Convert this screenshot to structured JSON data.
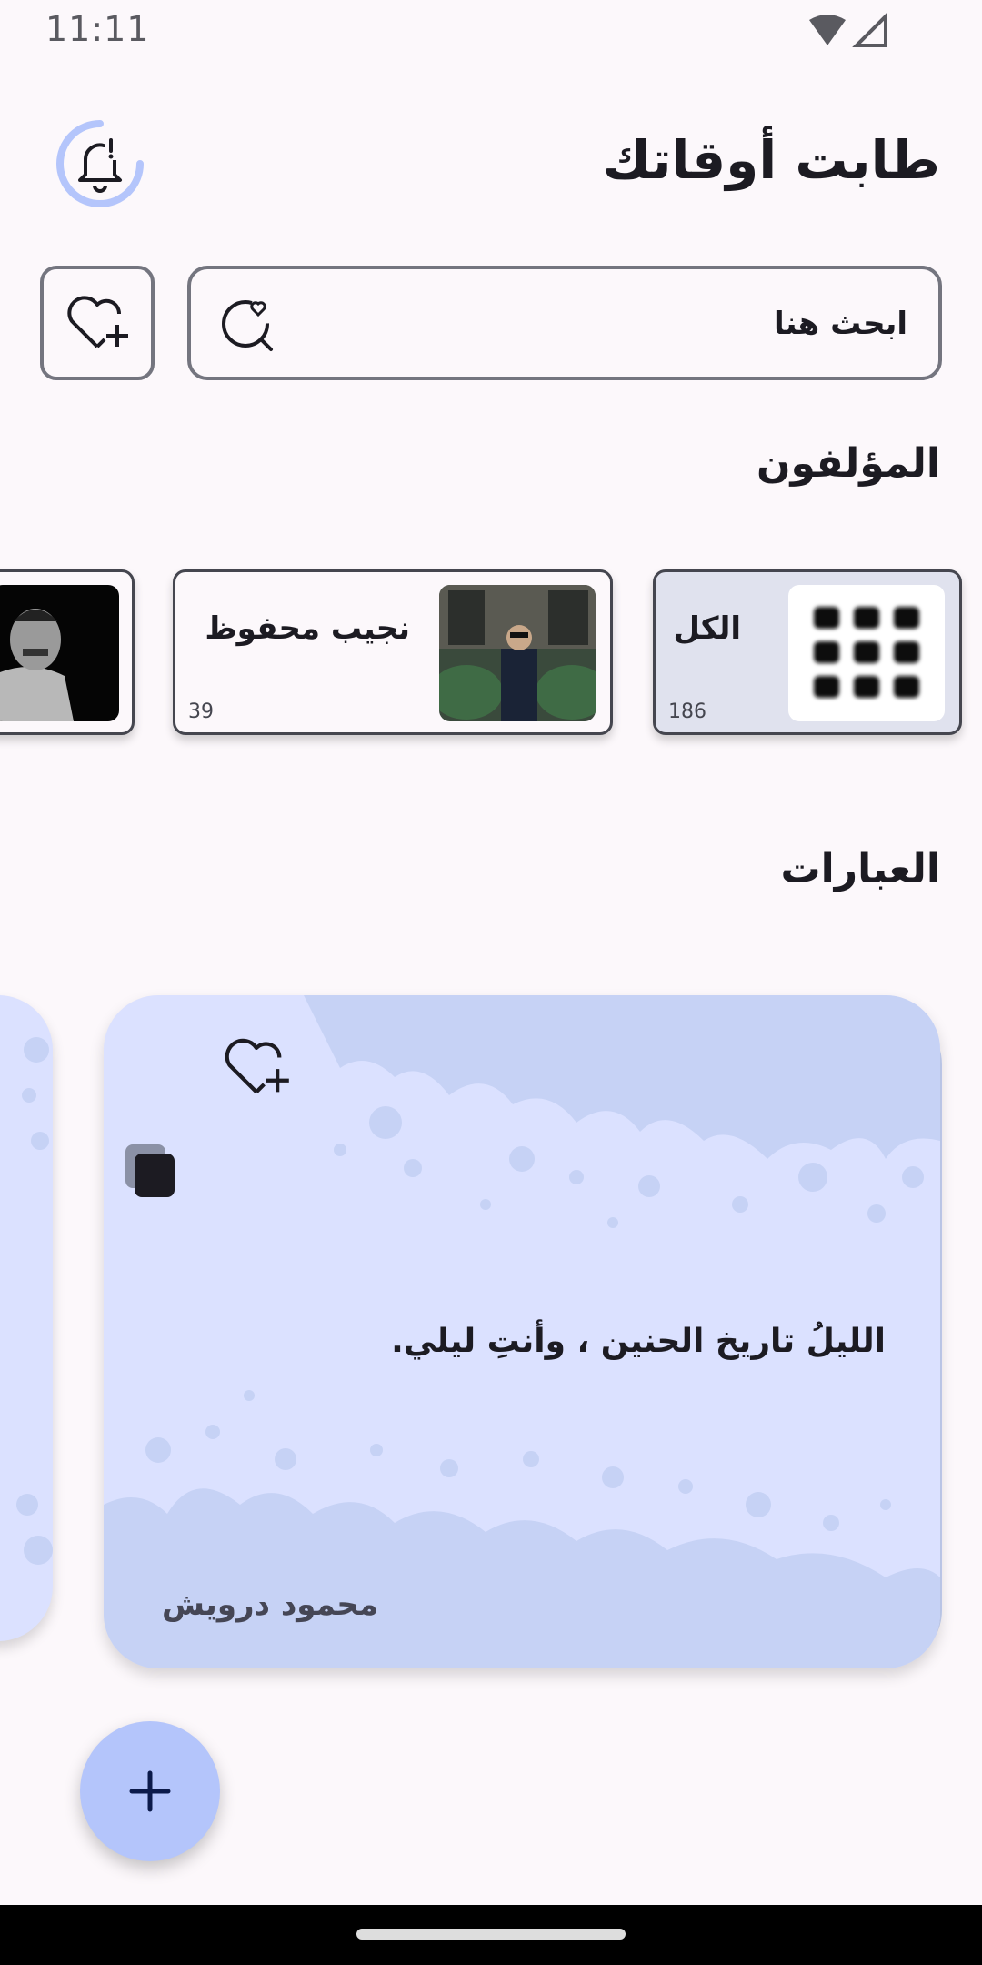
{
  "status_bar": {
    "time": "11:11",
    "icons": [
      "wifi-icon",
      "signal-icon"
    ]
  },
  "header": {
    "title": "طابت أوقاتك",
    "bell_icon": "bell-icon"
  },
  "search": {
    "placeholder": "ابحث هنا",
    "icon": "search-heart-icon",
    "favorite_add_icon": "heart-plus-icon"
  },
  "authors": {
    "title": "المؤلفون",
    "items": [
      {
        "name": "الكل",
        "count": "186",
        "icon": "grid-icon",
        "selected": true
      },
      {
        "name": "نجيب محفوظ",
        "count": "39",
        "icon": "author-photo"
      },
      {
        "name": "",
        "count": "",
        "icon": "author-photo"
      }
    ]
  },
  "quotes": {
    "title": "العبارات",
    "items": [
      {
        "text": "الليلُ تاريخ الحنين ، وأنتِ ليلي.",
        "author": "محمود درويش",
        "fav_icon": "heart-plus-icon",
        "copy_icon": "copy-icon"
      }
    ]
  },
  "fab": {
    "icon": "plus-icon",
    "label": "+"
  },
  "colors": {
    "background": "#fcf8fb",
    "card": "#dbe1ff",
    "fab": "#b4c5fb",
    "selected_author": "#e0e2ee"
  }
}
